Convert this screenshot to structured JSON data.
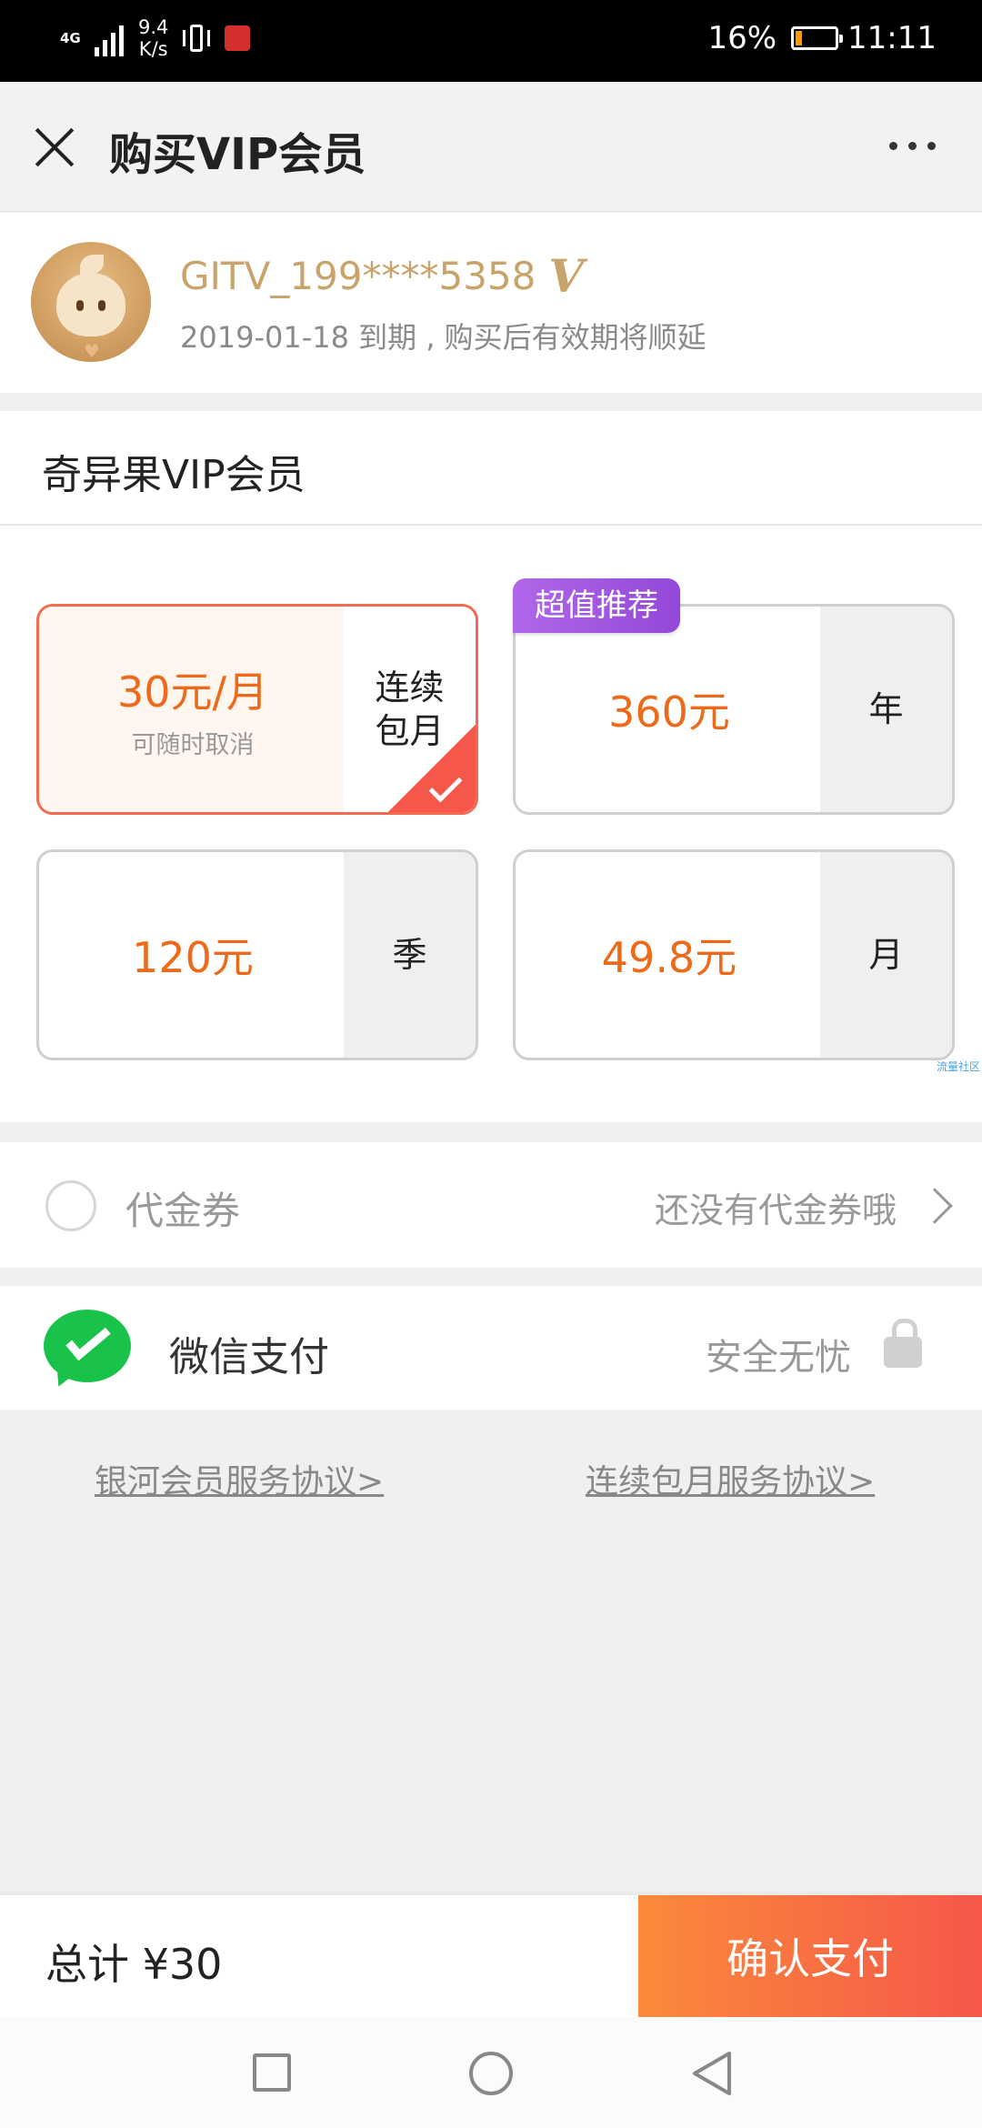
{
  "status_bar": {
    "network": "4G",
    "speed_value": "9.4",
    "speed_unit": "K/s",
    "battery": "16%",
    "time": "11:11",
    "battery_level": 0.16
  },
  "header": {
    "title": "购买VIP会员"
  },
  "user": {
    "name": "GITV_199****5358",
    "vip_mark": "V",
    "expire": "2019-01-18 到期 , 购买后有效期将顺延"
  },
  "section": {
    "title": "奇异果VIP会员"
  },
  "plans": [
    {
      "price": "30元/月",
      "sub": "可随时取消",
      "period_line1": "连续",
      "period_line2": "包月",
      "selected": true
    },
    {
      "price": "360元",
      "period": "年",
      "badge": "超值推荐"
    },
    {
      "price": "120元",
      "period": "季"
    },
    {
      "price": "49.8元",
      "period": "月"
    }
  ],
  "watermark": "流量社区",
  "coupon": {
    "label": "代金券",
    "status": "还没有代金券哦"
  },
  "payment": {
    "label": "微信支付",
    "safe_text": "安全无忧"
  },
  "agreements": {
    "galaxy": "银河会员服务协议>",
    "monthly": "连续包月服务协议>"
  },
  "footer": {
    "total": "总计 ¥30",
    "confirm": "确认支付"
  },
  "colors": {
    "accent": "#ec6a1a",
    "gold": "#c8a36b",
    "confirm_start": "#fb8a3a",
    "confirm_end": "#f5574a",
    "badge": "#a658e0",
    "wechat": "#19c34a"
  }
}
